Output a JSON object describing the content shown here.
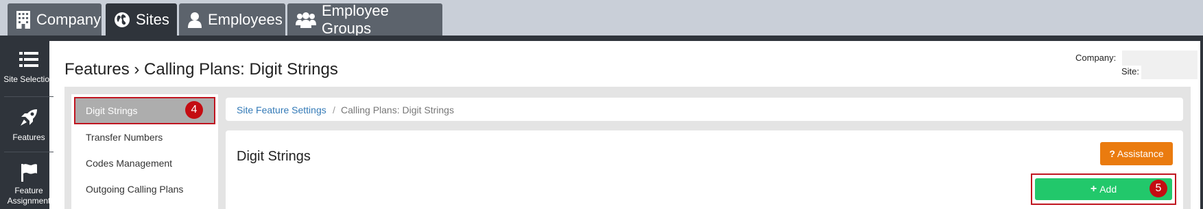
{
  "tabs": [
    {
      "label": "Company",
      "icon": "building-icon"
    },
    {
      "label": "Sites",
      "icon": "globe-icon",
      "active": true
    },
    {
      "label": "Employees",
      "icon": "user-icon"
    },
    {
      "label": "Employee Groups",
      "icon": "users-icon"
    }
  ],
  "sidebar": {
    "items": [
      {
        "label": "Site Selection",
        "icon": "list-icon"
      },
      {
        "label": "Features",
        "icon": "rocket-icon",
        "active": true
      },
      {
        "label": "Feature Assignment",
        "icon": "flag-icon"
      }
    ]
  },
  "header": {
    "title": "Features › Calling Plans: Digit Strings",
    "company_label": "Company:",
    "site_label": "Site:"
  },
  "menu": {
    "items": [
      "Digit Strings",
      "Transfer Numbers",
      "Codes Management",
      "Outgoing Calling Plans"
    ],
    "active": "Digit Strings",
    "annotation": "4"
  },
  "breadcrumb": {
    "link": "Site Feature Settings",
    "separator": "/",
    "current": "Calling Plans: Digit Strings"
  },
  "card": {
    "title": "Digit Strings",
    "assistance_label": "Assistance",
    "add_label": "Add",
    "annotation": "5"
  },
  "colors": {
    "frame": "#2f343b",
    "accent_orange": "#ea7b0f",
    "accent_green": "#22c86b",
    "link": "#337ab7",
    "highlight_red": "#c0141f"
  }
}
